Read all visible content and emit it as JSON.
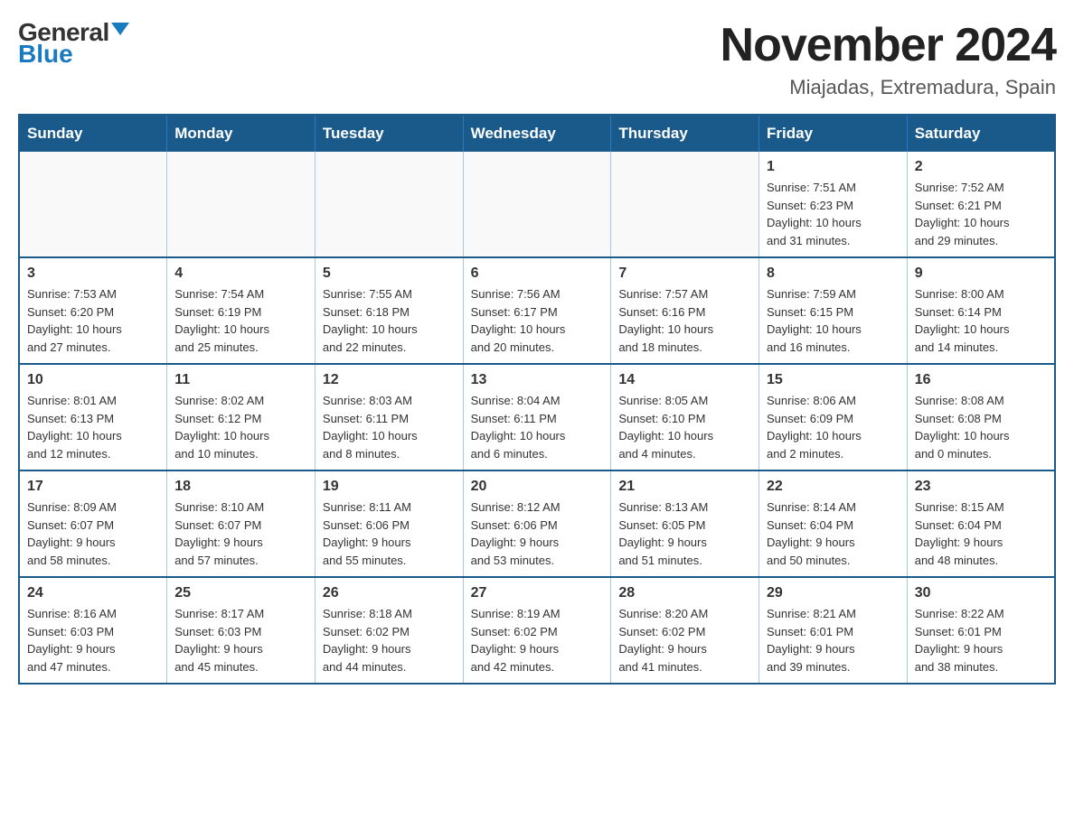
{
  "logo": {
    "general": "General",
    "blue": "Blue"
  },
  "title": "November 2024",
  "subtitle": "Miajadas, Extremadura, Spain",
  "weekdays": [
    "Sunday",
    "Monday",
    "Tuesday",
    "Wednesday",
    "Thursday",
    "Friday",
    "Saturday"
  ],
  "weeks": [
    [
      {
        "day": "",
        "info": ""
      },
      {
        "day": "",
        "info": ""
      },
      {
        "day": "",
        "info": ""
      },
      {
        "day": "",
        "info": ""
      },
      {
        "day": "",
        "info": ""
      },
      {
        "day": "1",
        "info": "Sunrise: 7:51 AM\nSunset: 6:23 PM\nDaylight: 10 hours\nand 31 minutes."
      },
      {
        "day": "2",
        "info": "Sunrise: 7:52 AM\nSunset: 6:21 PM\nDaylight: 10 hours\nand 29 minutes."
      }
    ],
    [
      {
        "day": "3",
        "info": "Sunrise: 7:53 AM\nSunset: 6:20 PM\nDaylight: 10 hours\nand 27 minutes."
      },
      {
        "day": "4",
        "info": "Sunrise: 7:54 AM\nSunset: 6:19 PM\nDaylight: 10 hours\nand 25 minutes."
      },
      {
        "day": "5",
        "info": "Sunrise: 7:55 AM\nSunset: 6:18 PM\nDaylight: 10 hours\nand 22 minutes."
      },
      {
        "day": "6",
        "info": "Sunrise: 7:56 AM\nSunset: 6:17 PM\nDaylight: 10 hours\nand 20 minutes."
      },
      {
        "day": "7",
        "info": "Sunrise: 7:57 AM\nSunset: 6:16 PM\nDaylight: 10 hours\nand 18 minutes."
      },
      {
        "day": "8",
        "info": "Sunrise: 7:59 AM\nSunset: 6:15 PM\nDaylight: 10 hours\nand 16 minutes."
      },
      {
        "day": "9",
        "info": "Sunrise: 8:00 AM\nSunset: 6:14 PM\nDaylight: 10 hours\nand 14 minutes."
      }
    ],
    [
      {
        "day": "10",
        "info": "Sunrise: 8:01 AM\nSunset: 6:13 PM\nDaylight: 10 hours\nand 12 minutes."
      },
      {
        "day": "11",
        "info": "Sunrise: 8:02 AM\nSunset: 6:12 PM\nDaylight: 10 hours\nand 10 minutes."
      },
      {
        "day": "12",
        "info": "Sunrise: 8:03 AM\nSunset: 6:11 PM\nDaylight: 10 hours\nand 8 minutes."
      },
      {
        "day": "13",
        "info": "Sunrise: 8:04 AM\nSunset: 6:11 PM\nDaylight: 10 hours\nand 6 minutes."
      },
      {
        "day": "14",
        "info": "Sunrise: 8:05 AM\nSunset: 6:10 PM\nDaylight: 10 hours\nand 4 minutes."
      },
      {
        "day": "15",
        "info": "Sunrise: 8:06 AM\nSunset: 6:09 PM\nDaylight: 10 hours\nand 2 minutes."
      },
      {
        "day": "16",
        "info": "Sunrise: 8:08 AM\nSunset: 6:08 PM\nDaylight: 10 hours\nand 0 minutes."
      }
    ],
    [
      {
        "day": "17",
        "info": "Sunrise: 8:09 AM\nSunset: 6:07 PM\nDaylight: 9 hours\nand 58 minutes."
      },
      {
        "day": "18",
        "info": "Sunrise: 8:10 AM\nSunset: 6:07 PM\nDaylight: 9 hours\nand 57 minutes."
      },
      {
        "day": "19",
        "info": "Sunrise: 8:11 AM\nSunset: 6:06 PM\nDaylight: 9 hours\nand 55 minutes."
      },
      {
        "day": "20",
        "info": "Sunrise: 8:12 AM\nSunset: 6:06 PM\nDaylight: 9 hours\nand 53 minutes."
      },
      {
        "day": "21",
        "info": "Sunrise: 8:13 AM\nSunset: 6:05 PM\nDaylight: 9 hours\nand 51 minutes."
      },
      {
        "day": "22",
        "info": "Sunrise: 8:14 AM\nSunset: 6:04 PM\nDaylight: 9 hours\nand 50 minutes."
      },
      {
        "day": "23",
        "info": "Sunrise: 8:15 AM\nSunset: 6:04 PM\nDaylight: 9 hours\nand 48 minutes."
      }
    ],
    [
      {
        "day": "24",
        "info": "Sunrise: 8:16 AM\nSunset: 6:03 PM\nDaylight: 9 hours\nand 47 minutes."
      },
      {
        "day": "25",
        "info": "Sunrise: 8:17 AM\nSunset: 6:03 PM\nDaylight: 9 hours\nand 45 minutes."
      },
      {
        "day": "26",
        "info": "Sunrise: 8:18 AM\nSunset: 6:02 PM\nDaylight: 9 hours\nand 44 minutes."
      },
      {
        "day": "27",
        "info": "Sunrise: 8:19 AM\nSunset: 6:02 PM\nDaylight: 9 hours\nand 42 minutes."
      },
      {
        "day": "28",
        "info": "Sunrise: 8:20 AM\nSunset: 6:02 PM\nDaylight: 9 hours\nand 41 minutes."
      },
      {
        "day": "29",
        "info": "Sunrise: 8:21 AM\nSunset: 6:01 PM\nDaylight: 9 hours\nand 39 minutes."
      },
      {
        "day": "30",
        "info": "Sunrise: 8:22 AM\nSunset: 6:01 PM\nDaylight: 9 hours\nand 38 minutes."
      }
    ]
  ]
}
